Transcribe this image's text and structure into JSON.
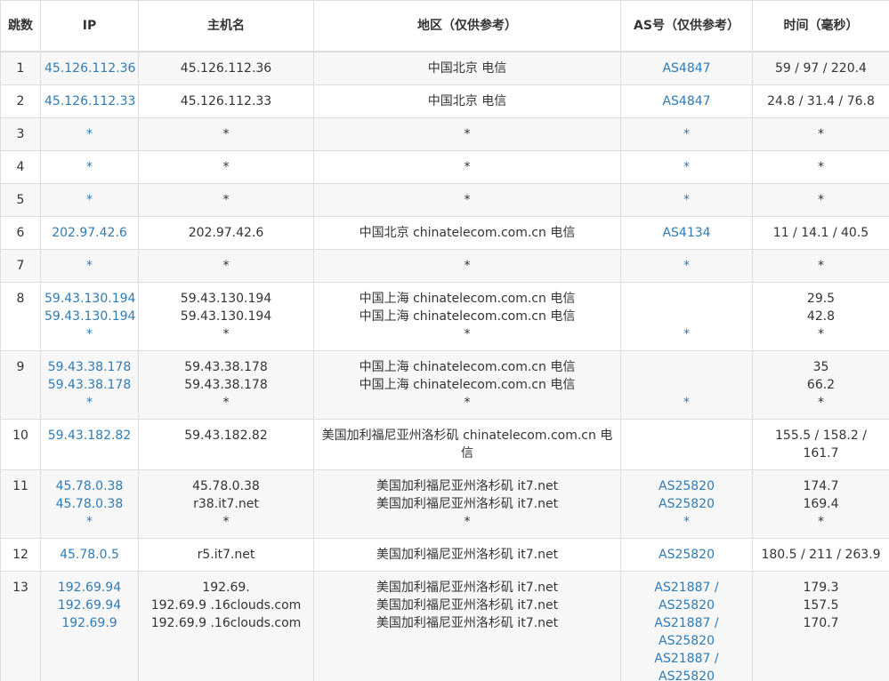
{
  "headers": {
    "hop": "跳数",
    "ip": "IP",
    "host": "主机名",
    "region": "地区（仅供参考）",
    "as": "AS号（仅供参考）",
    "time": "时间（毫秒）"
  },
  "rows": [
    {
      "hop": "1",
      "ip": [
        "45.126.112.36"
      ],
      "host": [
        "45.126.112.36"
      ],
      "region": [
        "中国北京 电信"
      ],
      "as": [
        "AS4847"
      ],
      "time": [
        "59 / 97 / 220.4"
      ]
    },
    {
      "hop": "2",
      "ip": [
        "45.126.112.33"
      ],
      "host": [
        "45.126.112.33"
      ],
      "region": [
        "中国北京 电信"
      ],
      "as": [
        "AS4847"
      ],
      "time": [
        "24.8 / 31.4 / 76.8"
      ]
    },
    {
      "hop": "3",
      "ip": [
        "*"
      ],
      "host": [
        "*"
      ],
      "region": [
        "*"
      ],
      "as": [
        "*"
      ],
      "time": [
        "*"
      ]
    },
    {
      "hop": "4",
      "ip": [
        "*"
      ],
      "host": [
        "*"
      ],
      "region": [
        "*"
      ],
      "as": [
        "*"
      ],
      "time": [
        "*"
      ]
    },
    {
      "hop": "5",
      "ip": [
        "*"
      ],
      "host": [
        "*"
      ],
      "region": [
        "*"
      ],
      "as": [
        "*"
      ],
      "time": [
        "*"
      ]
    },
    {
      "hop": "6",
      "ip": [
        "202.97.42.6"
      ],
      "host": [
        "202.97.42.6"
      ],
      "region": [
        "中国北京 chinatelecom.com.cn 电信"
      ],
      "as": [
        "AS4134"
      ],
      "time": [
        "11 / 14.1 / 40.5"
      ]
    },
    {
      "hop": "7",
      "ip": [
        "*"
      ],
      "host": [
        "*"
      ],
      "region": [
        "*"
      ],
      "as": [
        "*"
      ],
      "time": [
        "*"
      ]
    },
    {
      "hop": "8",
      "ip": [
        "59.43.130.194",
        "59.43.130.194",
        "*"
      ],
      "host": [
        "59.43.130.194",
        "59.43.130.194",
        "*"
      ],
      "region": [
        "中国上海 chinatelecom.com.cn 电信",
        "中国上海 chinatelecom.com.cn 电信",
        "*"
      ],
      "as": [
        "",
        "",
        "*"
      ],
      "time": [
        "29.5",
        "42.8",
        "*"
      ]
    },
    {
      "hop": "9",
      "ip": [
        "59.43.38.178",
        "59.43.38.178",
        "*"
      ],
      "host": [
        "59.43.38.178",
        "59.43.38.178",
        "*"
      ],
      "region": [
        "中国上海 chinatelecom.com.cn 电信",
        "中国上海 chinatelecom.com.cn 电信",
        "*"
      ],
      "as": [
        "",
        "",
        "*"
      ],
      "time": [
        "35",
        "66.2",
        "*"
      ]
    },
    {
      "hop": "10",
      "ip": [
        "59.43.182.82"
      ],
      "host": [
        "59.43.182.82"
      ],
      "region": [
        "美国加利福尼亚州洛杉矶 chinatelecom.com.cn 电",
        "信"
      ],
      "as": [
        ""
      ],
      "time": [
        "155.5 / 158.2 /",
        "161.7"
      ]
    },
    {
      "hop": "11",
      "ip": [
        "45.78.0.38",
        "45.78.0.38",
        "*"
      ],
      "host": [
        "45.78.0.38",
        "r38.it7.net",
        "*"
      ],
      "region": [
        "美国加利福尼亚州洛杉矶 it7.net",
        "美国加利福尼亚州洛杉矶 it7.net",
        "*"
      ],
      "as": [
        "AS25820",
        "AS25820",
        "*"
      ],
      "time": [
        "174.7",
        "169.4",
        "*"
      ]
    },
    {
      "hop": "12",
      "ip": [
        "45.78.0.5"
      ],
      "host": [
        "r5.it7.net"
      ],
      "region": [
        "美国加利福尼亚州洛杉矶 it7.net"
      ],
      "as": [
        "AS25820"
      ],
      "time": [
        "180.5 / 211 / 263.9"
      ]
    },
    {
      "hop": "13",
      "ip": [
        "192.69.94",
        "192.69.94",
        "192.69.9"
      ],
      "host": [
        "192.69.",
        "192.69.9 .16clouds.com",
        "192.69.9 .16clouds.com"
      ],
      "region": [
        "美国加利福尼亚州洛杉矶 it7.net",
        "美国加利福尼亚州洛杉矶 it7.net",
        "美国加利福尼亚州洛杉矶 it7.net"
      ],
      "as": [
        "AS21887 /",
        "AS25820",
        "AS21887 /",
        "AS25820",
        "AS21887 /",
        "AS25820"
      ],
      "time": [
        "179.3",
        "157.5",
        "170.7"
      ]
    }
  ]
}
